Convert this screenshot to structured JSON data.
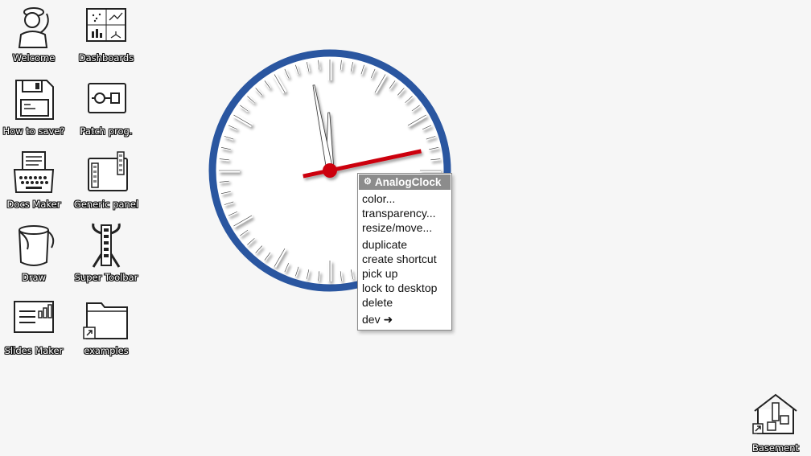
{
  "desktop": {
    "icons": [
      {
        "label": "Welcome",
        "icon": "welcome-person-icon"
      },
      {
        "label": "Dashboards",
        "icon": "dashboards-icon"
      },
      {
        "label": "How to save?",
        "icon": "floppy-disk-icon"
      },
      {
        "label": "Patch prog.",
        "icon": "patch-icon"
      },
      {
        "label": "Docs Maker",
        "icon": "typewriter-icon"
      },
      {
        "label": "Generic panel",
        "icon": "panel-icon"
      },
      {
        "label": "Draw",
        "icon": "paint-bucket-icon"
      },
      {
        "label": "Super Toolbar",
        "icon": "toolbar-robot-icon"
      },
      {
        "label": "Slides Maker",
        "icon": "slides-icon"
      },
      {
        "label": "examples",
        "icon": "folder-shortcut-icon"
      }
    ],
    "base": {
      "label": "Basement",
      "icon": "house-icon"
    }
  },
  "clock": {
    "widget": "AnalogClock",
    "time": {
      "hours": 11,
      "minutes": 58,
      "seconds": 13
    },
    "colors": {
      "rim": "#2a56a0",
      "face": "#ffffff",
      "hands": "#ffffff",
      "second_hand": "#cc0011"
    }
  },
  "context_menu": {
    "title": "AnalogClock",
    "title_icon": "gear-icon",
    "items": [
      "color...",
      "transparency...",
      "resize/move...",
      "duplicate",
      "create shortcut",
      "pick up",
      "lock to desktop",
      "delete",
      "dev ➜"
    ]
  }
}
